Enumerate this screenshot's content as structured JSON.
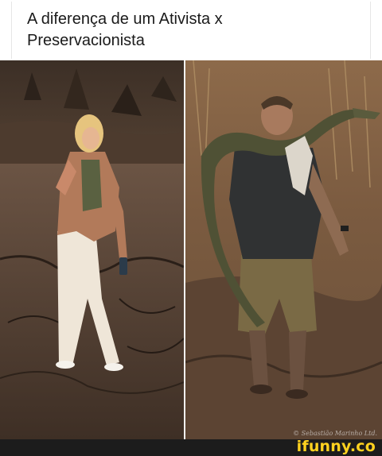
{
  "caption": {
    "text": "A diferença  de um Ativista x\nPreservacionista"
  },
  "photos": {
    "left_alt": "woman standing in burned land",
    "right_alt": "man carrying a caiman on his shoulders",
    "watermark": "© Sebastião Marinho Ltd."
  },
  "footer": {
    "brand": "ifunny.co",
    "brand_color": "#ffd21f"
  }
}
